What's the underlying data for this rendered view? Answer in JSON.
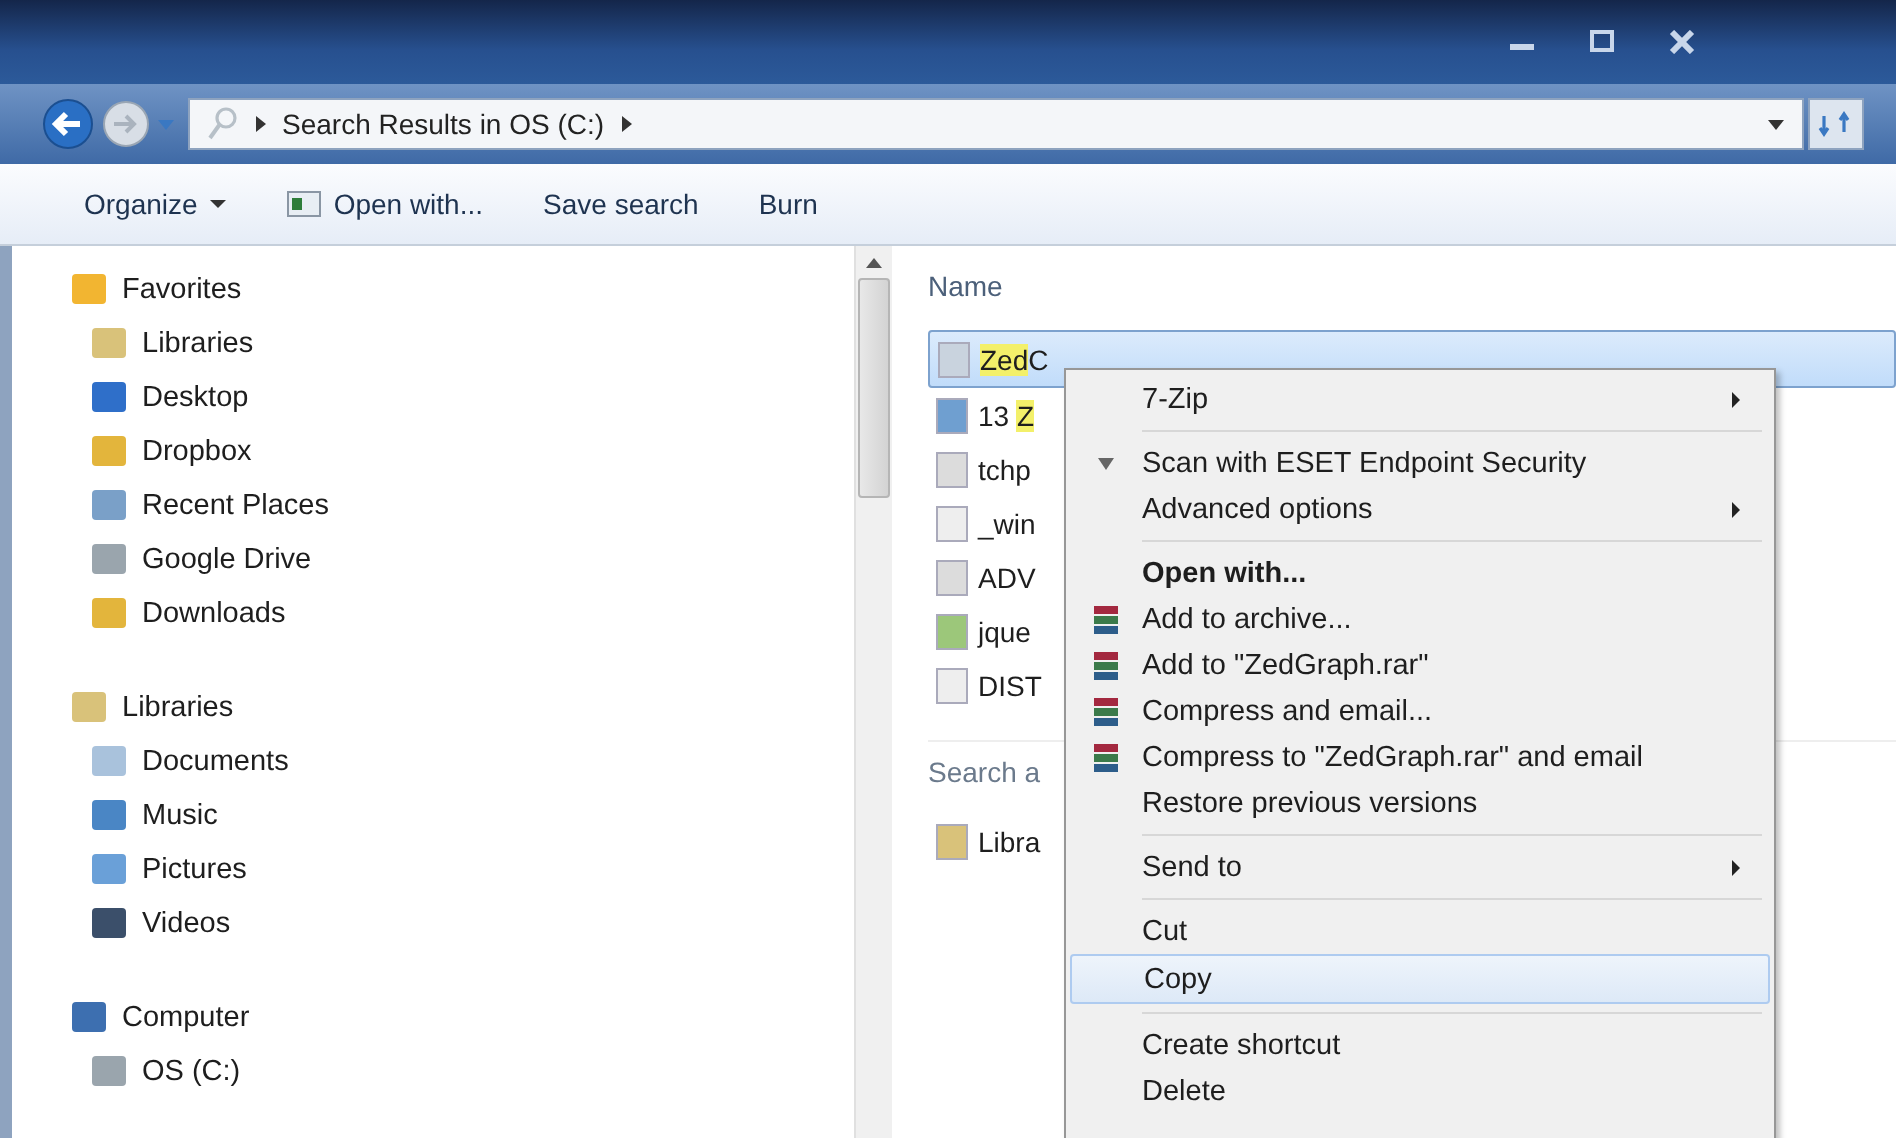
{
  "address_bar": {
    "path": "Search Results in OS (C:)"
  },
  "toolbar": [
    {
      "label": "Organize",
      "kind": "menu"
    },
    {
      "label": "Open with...",
      "kind": "icon"
    },
    {
      "label": "Save search",
      "kind": "plain"
    },
    {
      "label": "Burn",
      "kind": "plain"
    }
  ],
  "sidebar": {
    "groups": [
      {
        "label": "Favorites",
        "children": [
          {
            "label": "Libraries"
          },
          {
            "label": "Desktop"
          },
          {
            "label": "Dropbox"
          },
          {
            "label": "Recent Places"
          },
          {
            "label": "Google Drive"
          },
          {
            "label": "Downloads"
          }
        ]
      },
      {
        "label": "Libraries",
        "children": [
          {
            "label": "Documents"
          },
          {
            "label": "Music"
          },
          {
            "label": "Pictures"
          },
          {
            "label": "Videos"
          }
        ]
      },
      {
        "label": "Computer",
        "children": [
          {
            "label": "OS (C:)"
          }
        ]
      }
    ]
  },
  "content": {
    "column_header": "Name",
    "files": [
      {
        "match": "Zed",
        "after": "C",
        "selected": true
      },
      {
        "before": "13 ",
        "match": "Z",
        "selected": false
      },
      {
        "before": "tchp",
        "selected": false
      },
      {
        "before": "_win",
        "selected": false
      },
      {
        "before": "ADV",
        "selected": false
      },
      {
        "before": "jque",
        "selected": false
      },
      {
        "before": "DIST",
        "selected": false
      }
    ],
    "search_again": "Search a",
    "locations": [
      {
        "label": "Libra"
      }
    ]
  },
  "context_menu": [
    {
      "kind": "item",
      "label": "7-Zip",
      "submenu": true,
      "bold": false,
      "selected": false
    },
    {
      "kind": "separator"
    },
    {
      "kind": "scan",
      "label": "Scan with ESET Endpoint Security",
      "submenu": false,
      "bold": false,
      "selected": false
    },
    {
      "kind": "item",
      "label": "Advanced options",
      "submenu": true,
      "bold": false,
      "selected": false
    },
    {
      "kind": "separator"
    },
    {
      "kind": "item",
      "label": "Open with...",
      "submenu": false,
      "bold": true,
      "selected": false
    },
    {
      "kind": "archive",
      "label": "Add to archive...",
      "submenu": false,
      "bold": false,
      "selected": false
    },
    {
      "kind": "archive",
      "label": "Add to \"ZedGraph.rar\"",
      "submenu": false,
      "bold": false,
      "selected": false
    },
    {
      "kind": "archive",
      "label": "Compress and email...",
      "submenu": false,
      "bold": false,
      "selected": false
    },
    {
      "kind": "archive",
      "label": "Compress to \"ZedGraph.rar\" and email",
      "submenu": false,
      "bold": false,
      "selected": false
    },
    {
      "kind": "item",
      "label": "Restore previous versions",
      "submenu": false,
      "bold": false,
      "selected": false
    },
    {
      "kind": "separator"
    },
    {
      "kind": "item",
      "label": "Send to",
      "submenu": true,
      "bold": false,
      "selected": false
    },
    {
      "kind": "separator"
    },
    {
      "kind": "item",
      "label": "Cut",
      "submenu": false,
      "bold": false,
      "selected": false
    },
    {
      "kind": "item",
      "label": "Copy",
      "submenu": false,
      "bold": false,
      "selected": true
    },
    {
      "kind": "separator"
    },
    {
      "kind": "item",
      "label": "Create shortcut",
      "submenu": false,
      "bold": false,
      "selected": false
    },
    {
      "kind": "item",
      "label": "Delete",
      "submenu": false,
      "bold": false,
      "selected": false
    }
  ]
}
